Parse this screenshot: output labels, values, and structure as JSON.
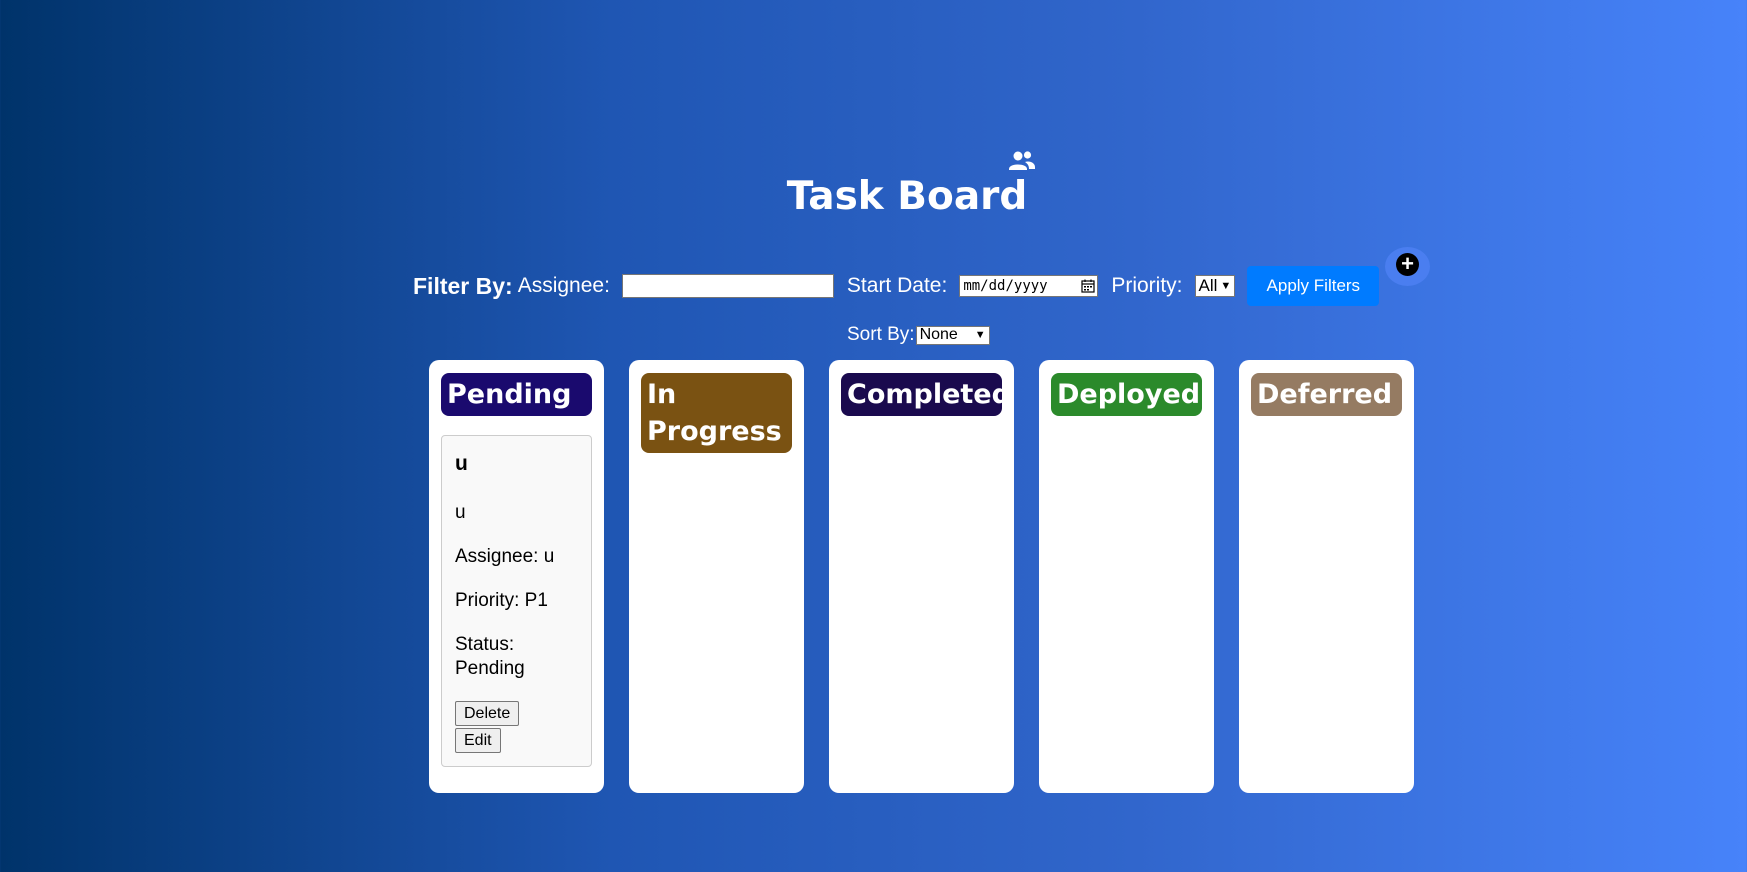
{
  "header": {
    "title": "Task Board",
    "users_icon": "users-icon"
  },
  "filters": {
    "filter_by_label": "Filter By:",
    "assignee_label": "Assignee:",
    "assignee_value": "",
    "start_date_label": "Start Date:",
    "start_date_placeholder": "mm/dd/yyyy",
    "priority_label": "Priority:",
    "priority_value": "All",
    "apply_label": "Apply Filters",
    "add_icon": "plus-icon"
  },
  "sort": {
    "label": "Sort By:",
    "value": "None"
  },
  "columns": [
    {
      "title": "Pending",
      "color": "#1a0a6e"
    },
    {
      "title": "In Progress",
      "color": "#7a5212"
    },
    {
      "title": "Completed",
      "color": "#1a0a4e"
    },
    {
      "title": "Deployed",
      "color": "#2b8a2b"
    },
    {
      "title": "Deferred",
      "color": "#957b62"
    }
  ],
  "tasks": [
    {
      "title": "u",
      "description": "u",
      "assignee": "Assignee: u",
      "priority": "Priority: P1",
      "status": "Status: Pending",
      "delete_label": "Delete",
      "edit_label": "Edit"
    }
  ]
}
